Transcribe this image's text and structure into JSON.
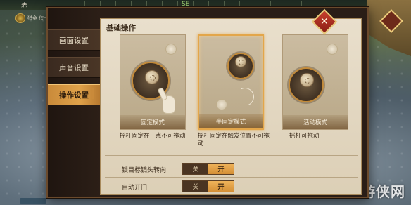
{
  "hud": {
    "top_left": "赤",
    "top_center": "SE",
    "player_name": "猎金·侠士"
  },
  "sidebar": {
    "items": [
      {
        "label": "画面设置",
        "active": false
      },
      {
        "label": "声音设置",
        "active": false
      },
      {
        "label": "操作设置",
        "active": true
      }
    ]
  },
  "panel": {
    "section_title": "基础操作",
    "modes": [
      {
        "caption": "固定模式",
        "description": "摇杆固定在一点不可拖动",
        "selected": false
      },
      {
        "caption": "半固定模式",
        "description": "摇杆固定在触发位置不可拖动",
        "selected": true
      },
      {
        "caption": "活动模式",
        "description": "摇杆可拖动",
        "selected": false
      }
    ],
    "settings": [
      {
        "label": "锁目标镜头转向:",
        "off_label": "关",
        "on_label": "开",
        "value": "开"
      },
      {
        "label": "自动开门:",
        "off_label": "关",
        "on_label": "开",
        "value": "开"
      }
    ]
  },
  "close_button": {
    "label": "✕"
  },
  "watermark": {
    "text": "游侠网"
  },
  "colors": {
    "accent": "#e0a24a",
    "panel_bg": "#e9dfcc",
    "frame": "#2a1d16",
    "close_red": "#c9402e"
  }
}
